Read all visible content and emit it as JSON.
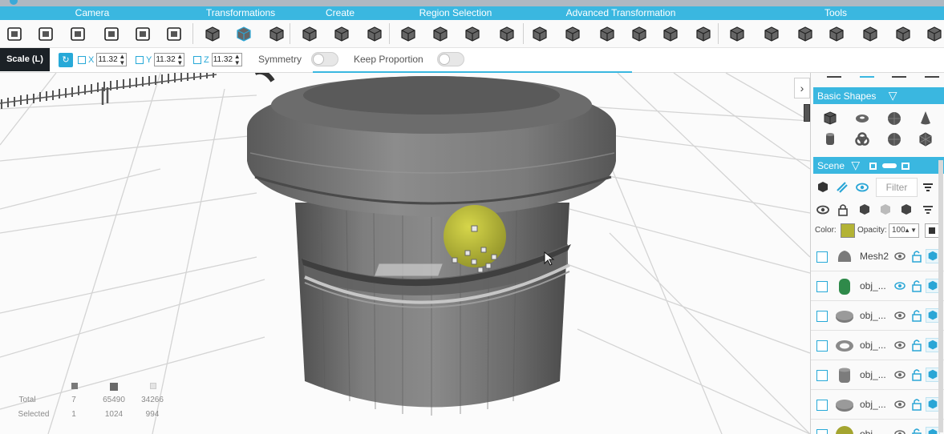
{
  "menu": {
    "items": [
      "Camera",
      "Transformations",
      "Create",
      "Region Selection",
      "Advanced Transformation",
      "Tools"
    ]
  },
  "toolbar": {
    "icons": [
      "save-icon",
      "select-icon",
      "import-icon",
      "rotate-view-icon",
      "camera-icon",
      "export-icon",
      "move-icon",
      "cube-icon",
      "scale-icon",
      "edit-mesh-icon",
      "extrude-icon",
      "box-icon",
      "solid-cube-icon",
      "cube-split-icon",
      "bounding-box-icon",
      "cube-hole-icon",
      "stack-icon",
      "wire-cube-icon",
      "cut-cube-icon",
      "cone-icon",
      "twist-icon",
      "slice-icon",
      "split-cube-icon",
      "boolean-icon",
      "grid-cube-icon",
      "sphere-icon",
      "cube-hex-icon",
      "cube-fill-icon",
      "check-cube-icon"
    ]
  },
  "options": {
    "mode_label": "Scale (L)",
    "reset_glyph": "↻",
    "axes": [
      {
        "label": "X",
        "value": "11.32"
      },
      {
        "label": "Y",
        "value": "11.32"
      },
      {
        "label": "Z",
        "value": "11.32"
      }
    ],
    "symmetry_label": "Symmetry",
    "keep_proportion_label": "Keep Proportion"
  },
  "viewport": {
    "stats": {
      "total_label": "Total",
      "selected_label": "Selected",
      "total": [
        "7",
        "65490",
        "34266"
      ],
      "selected": [
        "1",
        "1024",
        "994"
      ]
    }
  },
  "panel": {
    "toggle_glyph": "›",
    "basic_shapes_title": "Basic Shapes",
    "shapes": [
      "cube-icon",
      "torus-icon",
      "sphere-icon",
      "cone-icon",
      "cylinder-icon",
      "knot-icon",
      "ball-icon",
      "icosphere-icon"
    ],
    "scene_title": "Scene",
    "filter_placeholder": "Filter",
    "color_label": "Color:",
    "opacity_label": "Opacity:",
    "opacity_value": "100",
    "selected_color": "#b3b335",
    "layers": [
      {
        "name": "Mesh2",
        "shape": "mesh",
        "color": "#7a7a7a"
      },
      {
        "name": "obj_...",
        "shape": "cylinder",
        "color": "#2f8a4a"
      },
      {
        "name": "obj_...",
        "shape": "disk",
        "color": "#7c7c7c"
      },
      {
        "name": "obj_...",
        "shape": "ring",
        "color": "#8a8a8a"
      },
      {
        "name": "obj_...",
        "shape": "can",
        "color": "#7c7c7c"
      },
      {
        "name": "obj_...",
        "shape": "disk",
        "color": "#7c7c7c"
      },
      {
        "name": "obj_...",
        "shape": "sphere",
        "color": "#a4a530"
      }
    ]
  },
  "colors": {
    "accent": "#3ab7e0",
    "mode_bg": "#1b2126"
  }
}
